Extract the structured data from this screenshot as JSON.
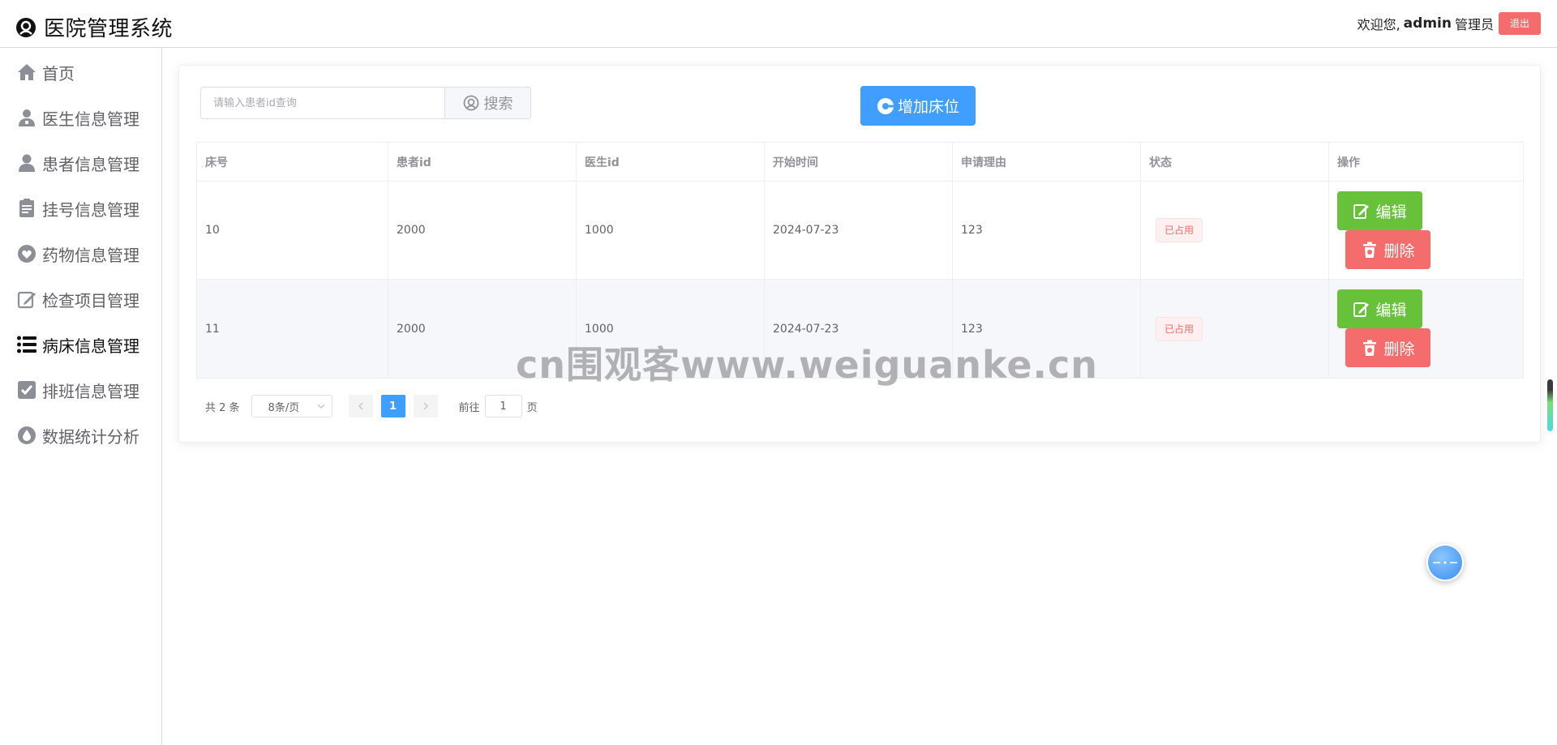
{
  "app": {
    "title": "医院管理系统"
  },
  "header": {
    "welcome": "欢迎您,",
    "username": "admin",
    "role": "管理员",
    "logout_label": "退出"
  },
  "sidebar": {
    "items": [
      {
        "label": "首页",
        "icon": "home-icon"
      },
      {
        "label": "医生信息管理",
        "icon": "doctor-icon"
      },
      {
        "label": "患者信息管理",
        "icon": "patient-icon"
      },
      {
        "label": "挂号信息管理",
        "icon": "clipboard-icon"
      },
      {
        "label": "药物信息管理",
        "icon": "medicine-icon"
      },
      {
        "label": "检查项目管理",
        "icon": "edit-document-icon"
      },
      {
        "label": "病床信息管理",
        "icon": "list-icon",
        "active": true
      },
      {
        "label": "排班信息管理",
        "icon": "checkbox-icon"
      },
      {
        "label": "数据统计分析",
        "icon": "drop-icon"
      }
    ]
  },
  "toolbar": {
    "search_placeholder": "请输入患者id查询",
    "search_label": "搜索",
    "add_label": "增加床位"
  },
  "table": {
    "columns": [
      "床号",
      "患者id",
      "医生id",
      "开始时间",
      "申请理由",
      "状态",
      "操作"
    ],
    "rows": [
      {
        "bed": "10",
        "patient_id": "2000",
        "doctor_id": "1000",
        "start": "2024-07-23",
        "reason": "123",
        "status": "已占用"
      },
      {
        "bed": "11",
        "patient_id": "2000",
        "doctor_id": "1000",
        "start": "2024-07-23",
        "reason": "123",
        "status": "已占用"
      }
    ],
    "edit_label": "编辑",
    "delete_label": "删除"
  },
  "pagination": {
    "total_text": "共 2 条",
    "page_size": "8条/页",
    "current_page": "1",
    "goto_prefix": "前往",
    "goto_value": "1",
    "goto_suffix": "页"
  },
  "watermark": "cn围观客www.weiguanke.cn",
  "colors": {
    "primary": "#409eff",
    "success": "#67c23a",
    "danger": "#f56c6c"
  }
}
